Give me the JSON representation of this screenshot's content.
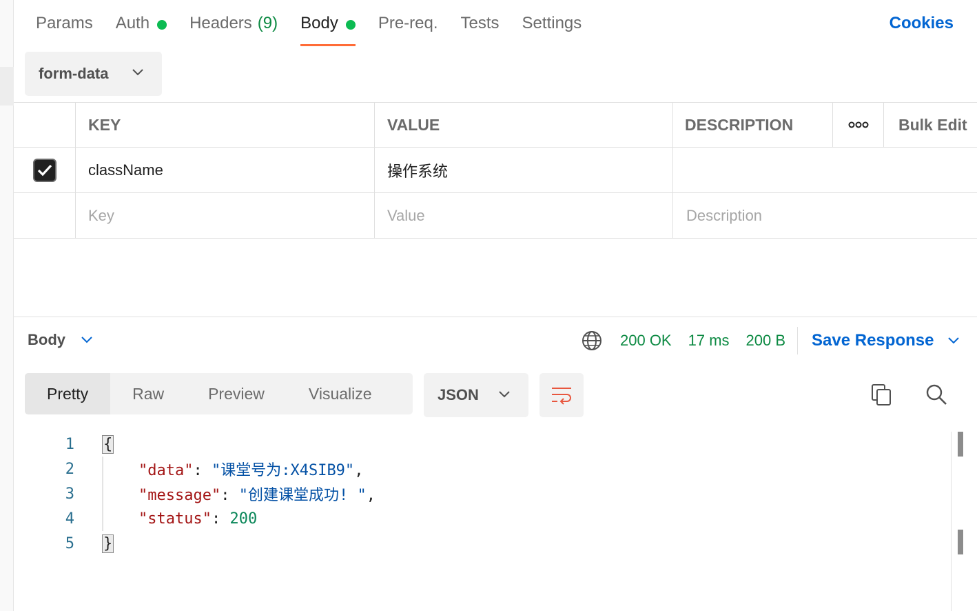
{
  "request_tabs": [
    {
      "label": "Params",
      "active": false
    },
    {
      "label": "Auth",
      "active": false,
      "dot": true
    },
    {
      "label": "Headers",
      "count": "(9)",
      "active": false
    },
    {
      "label": "Body",
      "active": true,
      "dot": true
    },
    {
      "label": "Pre-req.",
      "active": false
    },
    {
      "label": "Tests",
      "active": false
    },
    {
      "label": "Settings",
      "active": false
    }
  ],
  "cookies_label": "Cookies",
  "body_type": "form-data",
  "table": {
    "headers": {
      "key": "KEY",
      "value": "VALUE",
      "description": "DESCRIPTION",
      "bulk_edit": "Bulk Edit"
    },
    "rows": [
      {
        "checked": true,
        "key": "className",
        "value": "操作系统",
        "description": ""
      }
    ],
    "placeholders": {
      "key": "Key",
      "value": "Value",
      "description": "Description"
    }
  },
  "response": {
    "label": "Body",
    "status": "200 OK",
    "time": "17 ms",
    "size": "200 B",
    "save_label": "Save Response",
    "view_tabs": [
      "Pretty",
      "Raw",
      "Preview",
      "Visualize"
    ],
    "active_view": "Pretty",
    "format": "JSON"
  },
  "code": {
    "line_numbers": [
      "1",
      "2",
      "3",
      "4",
      "5"
    ],
    "open_brace": "{",
    "close_brace": "}",
    "entries": [
      {
        "key": "\"data\"",
        "value": "\"课堂号为:X4SIB9\"",
        "type": "string",
        "trail": ","
      },
      {
        "key": "\"message\"",
        "value": "\"创建课堂成功! \"",
        "type": "string",
        "trail": ","
      },
      {
        "key": "\"status\"",
        "value": "200",
        "type": "number",
        "trail": ""
      }
    ]
  },
  "colors": {
    "accent": "#ff6c37",
    "link": "#0265d2",
    "success": "#0d8a43",
    "dot": "#0cbb52"
  }
}
